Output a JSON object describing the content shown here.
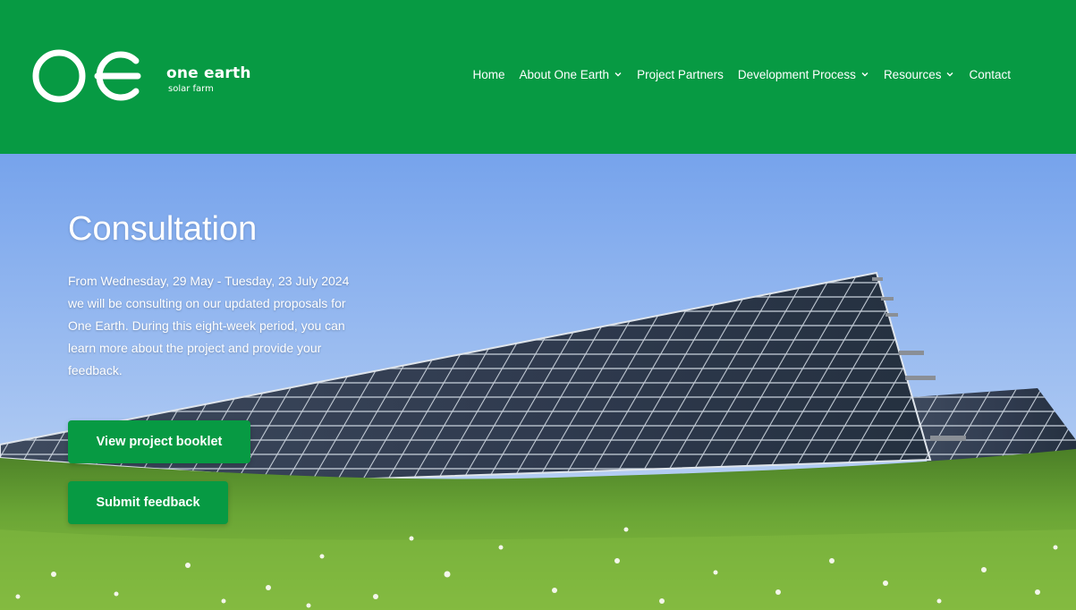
{
  "brand": {
    "name": "one earth",
    "tagline": "solar farm"
  },
  "nav": {
    "items": [
      {
        "label": "Home",
        "has_dropdown": false
      },
      {
        "label": "About One Earth",
        "has_dropdown": true
      },
      {
        "label": "Project Partners",
        "has_dropdown": false
      },
      {
        "label": "Development Process",
        "has_dropdown": true
      },
      {
        "label": "Resources",
        "has_dropdown": true
      },
      {
        "label": "Contact",
        "has_dropdown": false
      }
    ]
  },
  "hero": {
    "title": "Consultation",
    "body": "From Wednesday, 29 May - Tuesday, 23 July 2024 we will be consulting on our updated proposals for One Earth. During this eight-week period, you can learn more about the project and provide your feedback.",
    "buttons": {
      "booklet": "View project booklet",
      "feedback": "Submit feedback"
    }
  },
  "colors": {
    "brand_green": "#079a43",
    "sky": "#7fa9ea",
    "grass": "#5d9b2e",
    "text_on_brand": "#ffffff"
  }
}
